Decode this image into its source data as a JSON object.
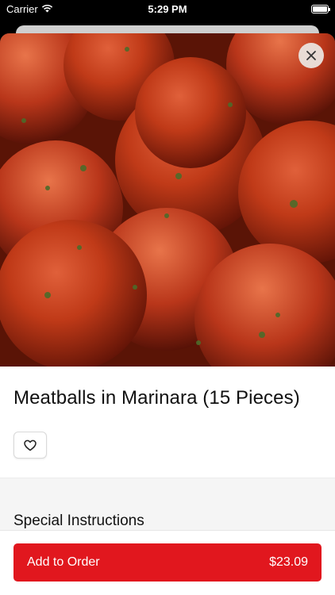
{
  "status_bar": {
    "carrier": "Carrier",
    "time": "5:29 PM",
    "wifi_icon": "wifi-icon",
    "battery_icon": "battery-icon"
  },
  "hero": {
    "image_subject": "meatballs in marinara sauce"
  },
  "item": {
    "title": "Meatballs in Marinara (15 Pieces)"
  },
  "actions": {
    "close_icon": "close-icon",
    "favorite_icon": "heart-icon"
  },
  "sections": {
    "special_instructions_title": "Special Instructions"
  },
  "order": {
    "add_label": "Add to Order",
    "price": "$23.09"
  },
  "colors": {
    "accent": "#e1171e",
    "sauce": "#a92c10"
  }
}
